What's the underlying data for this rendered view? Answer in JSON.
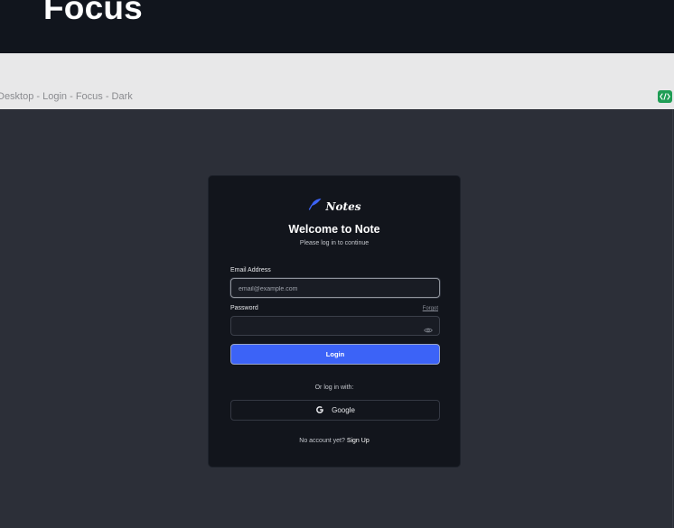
{
  "banner": {
    "title": "Focus"
  },
  "frame": {
    "label": "Desktop - Login - Focus - Dark",
    "badge_icon": "code-icon"
  },
  "brand": {
    "name": "Notes",
    "icon": "feather-icon",
    "accent": "#3c63f7"
  },
  "header": {
    "welcome": "Welcome to Note",
    "subtitle": "Please log in to continue"
  },
  "form": {
    "email_label": "Email Address",
    "email_placeholder": "email@example.com",
    "email_value": "",
    "password_label": "Password",
    "password_value": "",
    "forgot_label": "Forgot",
    "login_label": "Login"
  },
  "social": {
    "divider": "Or log in with:",
    "google_label": "Google"
  },
  "signup": {
    "prompt": "No account yet?",
    "link": "Sign Up"
  }
}
